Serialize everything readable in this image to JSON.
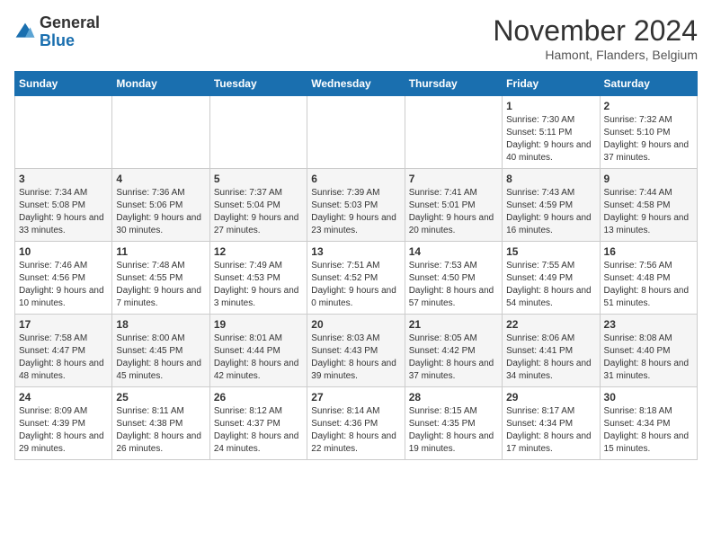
{
  "logo": {
    "general": "General",
    "blue": "Blue"
  },
  "header": {
    "month": "November 2024",
    "location": "Hamont, Flanders, Belgium"
  },
  "weekdays": [
    "Sunday",
    "Monday",
    "Tuesday",
    "Wednesday",
    "Thursday",
    "Friday",
    "Saturday"
  ],
  "weeks": [
    [
      {
        "day": "",
        "info": ""
      },
      {
        "day": "",
        "info": ""
      },
      {
        "day": "",
        "info": ""
      },
      {
        "day": "",
        "info": ""
      },
      {
        "day": "",
        "info": ""
      },
      {
        "day": "1",
        "info": "Sunrise: 7:30 AM\nSunset: 5:11 PM\nDaylight: 9 hours\nand 40 minutes."
      },
      {
        "day": "2",
        "info": "Sunrise: 7:32 AM\nSunset: 5:10 PM\nDaylight: 9 hours\nand 37 minutes."
      }
    ],
    [
      {
        "day": "3",
        "info": "Sunrise: 7:34 AM\nSunset: 5:08 PM\nDaylight: 9 hours\nand 33 minutes."
      },
      {
        "day": "4",
        "info": "Sunrise: 7:36 AM\nSunset: 5:06 PM\nDaylight: 9 hours\nand 30 minutes."
      },
      {
        "day": "5",
        "info": "Sunrise: 7:37 AM\nSunset: 5:04 PM\nDaylight: 9 hours\nand 27 minutes."
      },
      {
        "day": "6",
        "info": "Sunrise: 7:39 AM\nSunset: 5:03 PM\nDaylight: 9 hours\nand 23 minutes."
      },
      {
        "day": "7",
        "info": "Sunrise: 7:41 AM\nSunset: 5:01 PM\nDaylight: 9 hours\nand 20 minutes."
      },
      {
        "day": "8",
        "info": "Sunrise: 7:43 AM\nSunset: 4:59 PM\nDaylight: 9 hours\nand 16 minutes."
      },
      {
        "day": "9",
        "info": "Sunrise: 7:44 AM\nSunset: 4:58 PM\nDaylight: 9 hours\nand 13 minutes."
      }
    ],
    [
      {
        "day": "10",
        "info": "Sunrise: 7:46 AM\nSunset: 4:56 PM\nDaylight: 9 hours\nand 10 minutes."
      },
      {
        "day": "11",
        "info": "Sunrise: 7:48 AM\nSunset: 4:55 PM\nDaylight: 9 hours\nand 7 minutes."
      },
      {
        "day": "12",
        "info": "Sunrise: 7:49 AM\nSunset: 4:53 PM\nDaylight: 9 hours\nand 3 minutes."
      },
      {
        "day": "13",
        "info": "Sunrise: 7:51 AM\nSunset: 4:52 PM\nDaylight: 9 hours\nand 0 minutes."
      },
      {
        "day": "14",
        "info": "Sunrise: 7:53 AM\nSunset: 4:50 PM\nDaylight: 8 hours\nand 57 minutes."
      },
      {
        "day": "15",
        "info": "Sunrise: 7:55 AM\nSunset: 4:49 PM\nDaylight: 8 hours\nand 54 minutes."
      },
      {
        "day": "16",
        "info": "Sunrise: 7:56 AM\nSunset: 4:48 PM\nDaylight: 8 hours\nand 51 minutes."
      }
    ],
    [
      {
        "day": "17",
        "info": "Sunrise: 7:58 AM\nSunset: 4:47 PM\nDaylight: 8 hours\nand 48 minutes."
      },
      {
        "day": "18",
        "info": "Sunrise: 8:00 AM\nSunset: 4:45 PM\nDaylight: 8 hours\nand 45 minutes."
      },
      {
        "day": "19",
        "info": "Sunrise: 8:01 AM\nSunset: 4:44 PM\nDaylight: 8 hours\nand 42 minutes."
      },
      {
        "day": "20",
        "info": "Sunrise: 8:03 AM\nSunset: 4:43 PM\nDaylight: 8 hours\nand 39 minutes."
      },
      {
        "day": "21",
        "info": "Sunrise: 8:05 AM\nSunset: 4:42 PM\nDaylight: 8 hours\nand 37 minutes."
      },
      {
        "day": "22",
        "info": "Sunrise: 8:06 AM\nSunset: 4:41 PM\nDaylight: 8 hours\nand 34 minutes."
      },
      {
        "day": "23",
        "info": "Sunrise: 8:08 AM\nSunset: 4:40 PM\nDaylight: 8 hours\nand 31 minutes."
      }
    ],
    [
      {
        "day": "24",
        "info": "Sunrise: 8:09 AM\nSunset: 4:39 PM\nDaylight: 8 hours\nand 29 minutes."
      },
      {
        "day": "25",
        "info": "Sunrise: 8:11 AM\nSunset: 4:38 PM\nDaylight: 8 hours\nand 26 minutes."
      },
      {
        "day": "26",
        "info": "Sunrise: 8:12 AM\nSunset: 4:37 PM\nDaylight: 8 hours\nand 24 minutes."
      },
      {
        "day": "27",
        "info": "Sunrise: 8:14 AM\nSunset: 4:36 PM\nDaylight: 8 hours\nand 22 minutes."
      },
      {
        "day": "28",
        "info": "Sunrise: 8:15 AM\nSunset: 4:35 PM\nDaylight: 8 hours\nand 19 minutes."
      },
      {
        "day": "29",
        "info": "Sunrise: 8:17 AM\nSunset: 4:34 PM\nDaylight: 8 hours\nand 17 minutes."
      },
      {
        "day": "30",
        "info": "Sunrise: 8:18 AM\nSunset: 4:34 PM\nDaylight: 8 hours\nand 15 minutes."
      }
    ]
  ]
}
